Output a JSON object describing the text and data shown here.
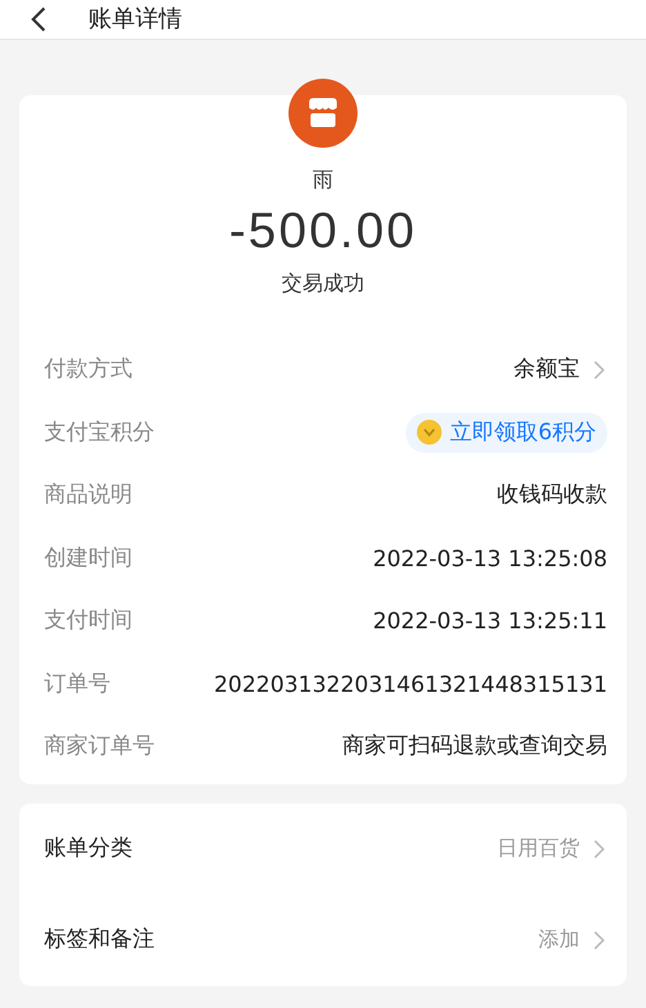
{
  "header": {
    "title": "账单详情"
  },
  "summary": {
    "payee": "雨",
    "amount": "-500.00",
    "status": "交易成功"
  },
  "details": [
    {
      "kind": "link",
      "label": "付款方式",
      "value": "余额宝"
    },
    {
      "kind": "badge",
      "label": "支付宝积分",
      "value": "立即领取6积分"
    },
    {
      "kind": "plain",
      "label": "商品说明",
      "value": "收钱码收款"
    },
    {
      "kind": "plain",
      "label": "创建时间",
      "value": "2022-03-13 13:25:08"
    },
    {
      "kind": "plain",
      "label": "支付时间",
      "value": "2022-03-13 13:25:11"
    },
    {
      "kind": "plain",
      "label": "订单号",
      "value": "2022031322031461321448315131"
    },
    {
      "kind": "plain",
      "label": "商家订单号",
      "value": "商家可扫码退款或查询交易"
    }
  ],
  "extras": [
    {
      "kind": "link",
      "label": "账单分类",
      "value": "日用百货"
    },
    {
      "kind": "link",
      "label": "标签和备注",
      "value": "添加"
    }
  ]
}
